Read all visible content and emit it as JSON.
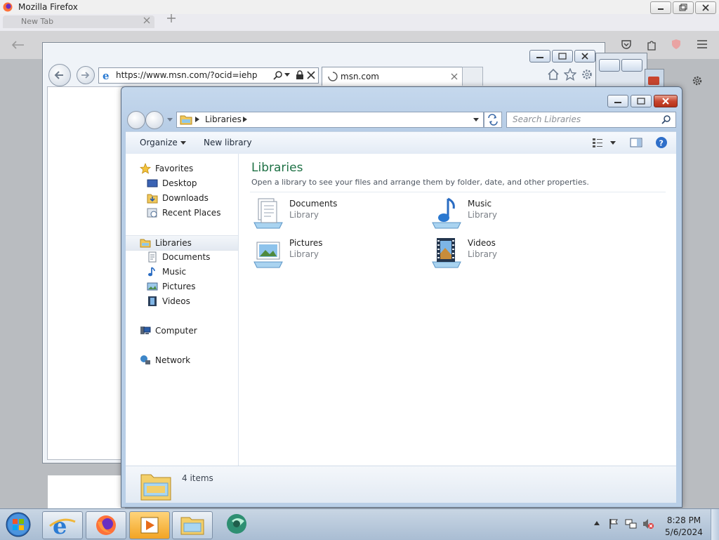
{
  "firefox": {
    "window_title": "Mozilla Firefox",
    "tab_label": "New Tab"
  },
  "ie": {
    "url": "https://www.msn.com/?ocid=iehp",
    "tab_label": "msn.com"
  },
  "explorer": {
    "breadcrumb": "Libraries",
    "search_placeholder": "Search Libraries",
    "toolbar": {
      "organize_label": "Organize",
      "new_library_label": "New library"
    },
    "nav": {
      "favorites": {
        "label": "Favorites",
        "items": [
          {
            "label": "Desktop"
          },
          {
            "label": "Downloads"
          },
          {
            "label": "Recent Places"
          }
        ]
      },
      "libraries": {
        "label": "Libraries",
        "items": [
          {
            "label": "Documents"
          },
          {
            "label": "Music"
          },
          {
            "label": "Pictures"
          },
          {
            "label": "Videos"
          }
        ]
      },
      "computer_label": "Computer",
      "network_label": "Network"
    },
    "main": {
      "heading": "Libraries",
      "description": "Open a library to see your files and arrange them by folder, date, and other properties.",
      "items": [
        {
          "name": "Documents",
          "type": "Library",
          "icon": "documents-library-icon"
        },
        {
          "name": "Music",
          "type": "Library",
          "icon": "music-library-icon"
        },
        {
          "name": "Pictures",
          "type": "Library",
          "icon": "pictures-library-icon"
        },
        {
          "name": "Videos",
          "type": "Library",
          "icon": "videos-library-icon"
        }
      ]
    },
    "status": {
      "item_count": "4 items"
    }
  },
  "taskbar": {
    "time": "8:28 PM",
    "date": "5/6/2024"
  },
  "colors": {
    "heading_green": "#1e7145",
    "explorer_frame": "#b9cfe7",
    "close_red": "#c8452f"
  }
}
